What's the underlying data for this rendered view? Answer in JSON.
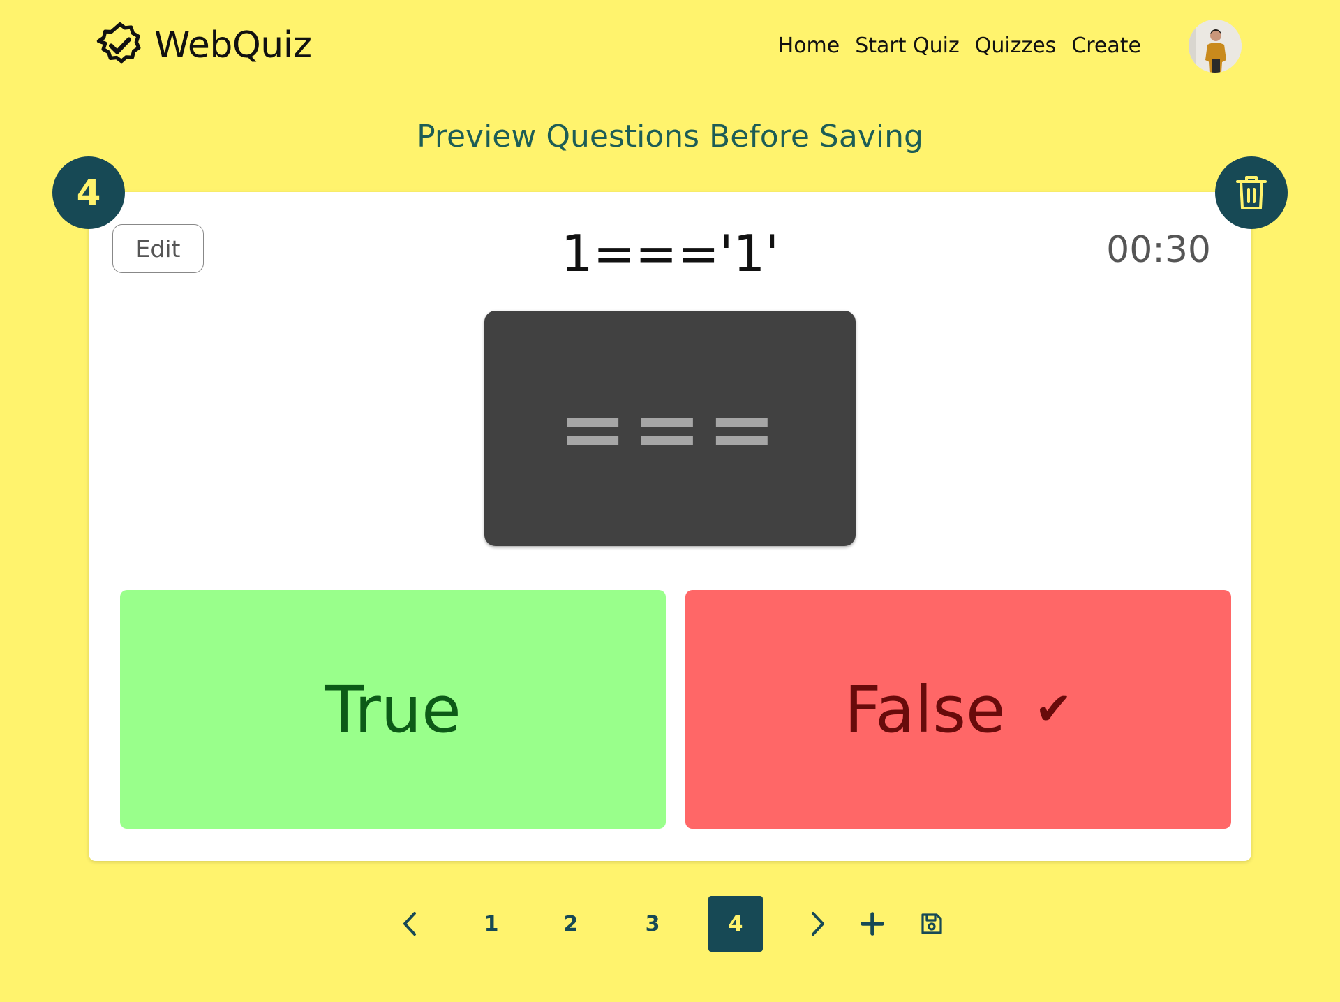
{
  "app": {
    "name": "WebQuiz"
  },
  "nav": {
    "items": [
      "Home",
      "Start Quiz",
      "Quizzes",
      "Create"
    ]
  },
  "page": {
    "title": "Preview Questions Before Saving"
  },
  "question": {
    "number": "4",
    "text": "1==='1'",
    "timer": "00:30",
    "edit_label": "Edit",
    "image_text": "===",
    "answers": [
      {
        "label": "True",
        "correct": false,
        "color": "#99ff8b"
      },
      {
        "label": "False",
        "correct": true,
        "color": "#ff6767"
      }
    ],
    "check_mark": "✔"
  },
  "pagination": {
    "pages": [
      "1",
      "2",
      "3",
      "4"
    ],
    "current": "4"
  },
  "colors": {
    "background": "#fff36d",
    "accent": "#174955",
    "title": "#1d5d56"
  }
}
